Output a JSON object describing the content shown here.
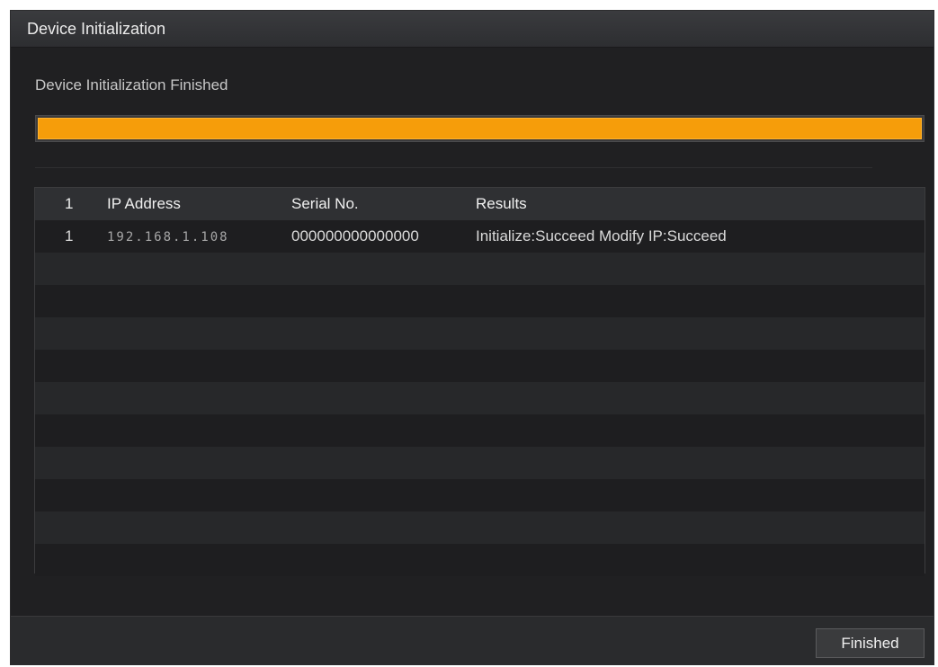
{
  "window": {
    "title": "Device Initialization"
  },
  "status": {
    "text": "Device Initialization Finished",
    "progress_percent": 100,
    "progress_color": "#f69d0a"
  },
  "table": {
    "headers": {
      "index": "1",
      "ip": "IP Address",
      "serial": "Serial No.",
      "results": "Results"
    },
    "rows": [
      {
        "index": "1",
        "ip": "192.168.1.108",
        "serial": "000000000000000",
        "results": "Initialize:Succeed Modify IP:Succeed"
      }
    ]
  },
  "footer": {
    "finish_label": "Finished"
  }
}
